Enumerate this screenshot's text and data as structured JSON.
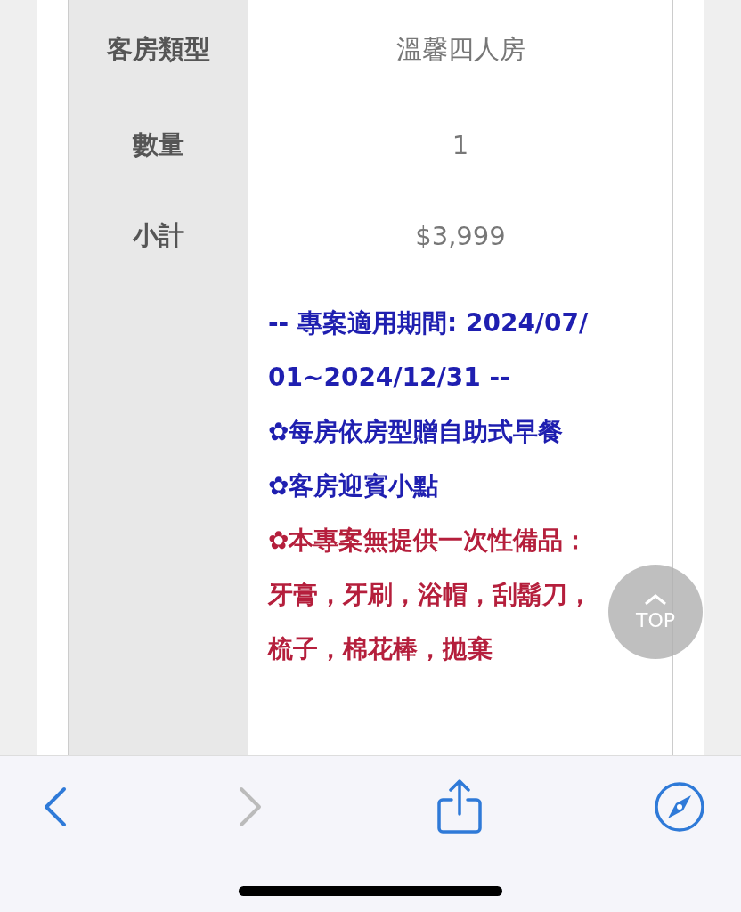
{
  "table": {
    "rows": [
      {
        "label": "客房類型",
        "value": "溫馨四人房"
      },
      {
        "label": "數量",
        "value": "1"
      },
      {
        "label": "小計",
        "value": "$3,999"
      }
    ],
    "notes": [
      {
        "text": "-- 專案適用期間: 2024/07/01~2024/12/31 --",
        "color": "#1f1fb0"
      },
      {
        "text": "✿每房依房型贈自助式早餐",
        "color": "#1f1fb0"
      },
      {
        "text": "✿客房迎賓小點",
        "color": "#1f1fb0"
      },
      {
        "text": "✿本專案無提供一次性備品：牙膏，牙刷，浴帽，刮鬍刀，梳子，棉花棒，拋棄",
        "color": "#b51f3c"
      }
    ]
  },
  "top_button": {
    "label": "TOP"
  },
  "toolbar": {
    "buttons": [
      {
        "kind": "back",
        "disabled": false
      },
      {
        "kind": "forward",
        "disabled": true
      },
      {
        "kind": "share",
        "disabled": false
      },
      {
        "kind": "compass",
        "disabled": false
      }
    ]
  }
}
